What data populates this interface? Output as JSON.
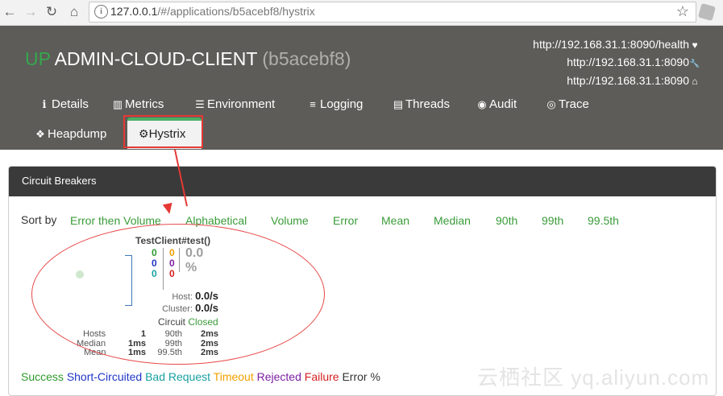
{
  "browser": {
    "url_host": "127.0.0.1",
    "url_path": "/#/applications/b5acebf8/hystrix",
    "lock_label": "i",
    "star_label": "☆"
  },
  "app": {
    "status": "UP",
    "name": "ADMIN-CLOUD-CLIENT",
    "id": "(b5acebf8)",
    "links": [
      {
        "text": "http://192.168.31.1:8090/health",
        "icon": "heartbeat-icon",
        "glyph": "♥"
      },
      {
        "text": "http://192.168.31.1:8090",
        "icon": "wrench-icon",
        "glyph": "🔧"
      },
      {
        "text": "http://192.168.31.1:8090",
        "icon": "home-icon",
        "glyph": "⌂"
      }
    ]
  },
  "tabs": [
    {
      "label": "Details",
      "icon": "info-icon",
      "glyph": "ℹ"
    },
    {
      "label": "Metrics",
      "icon": "bar-chart-icon",
      "glyph": "▥"
    },
    {
      "label": "Environment",
      "icon": "list-icon",
      "glyph": "☰"
    },
    {
      "label": "Logging",
      "icon": "sliders-icon",
      "glyph": "≡"
    },
    {
      "label": "Threads",
      "icon": "table-icon",
      "glyph": "▤"
    },
    {
      "label": "Audit",
      "icon": "user-circle-icon",
      "glyph": "◉"
    },
    {
      "label": "Trace",
      "icon": "eye-icon",
      "glyph": "◎"
    },
    {
      "label": "Heapdump",
      "icon": "cubes-icon",
      "glyph": "❖"
    },
    {
      "label": "Hystrix",
      "icon": "gear-icon",
      "glyph": "⚙",
      "active": true
    }
  ],
  "panel": {
    "title": "Circuit Breakers",
    "sort_label": "Sort by",
    "sort_options": [
      "Error then Volume",
      "Alphabetical",
      "Volume",
      "Error",
      "Mean",
      "Median",
      "90th",
      "99th",
      "99.5th"
    ]
  },
  "circuit": {
    "name": "TestClient#test()",
    "counts_left": [
      "0",
      "0",
      "0"
    ],
    "counts_right": [
      "0",
      "0",
      "0"
    ],
    "error_pct": "0.0 %",
    "host_label": "Host:",
    "host_rate": "0.0/s",
    "cluster_label": "Cluster:",
    "cluster_rate": "0.0/s",
    "circuit_label": "Circuit",
    "circuit_state": "Closed",
    "stats": {
      "labels_left": [
        "Hosts",
        "Median",
        "Mean"
      ],
      "values_left": [
        "1",
        "1ms",
        "1ms"
      ],
      "labels_right": [
        "90th",
        "99th",
        "99.5th"
      ],
      "values_right": [
        "2ms",
        "2ms",
        "2ms"
      ]
    }
  },
  "legend": [
    {
      "text": "Success",
      "color": "#2e9a2e"
    },
    {
      "text": "Short-Circuited",
      "color": "#1f35c8"
    },
    {
      "text": "Bad Request",
      "color": "#19a0a0"
    },
    {
      "text": "Timeout",
      "color": "#f0a000"
    },
    {
      "text": "Rejected",
      "color": "#7b1fa2"
    },
    {
      "text": "Failure",
      "color": "#d62020"
    },
    {
      "text": "Error %",
      "color": "#333333"
    }
  ],
  "watermark": "云栖社区 yq.aliyun.com"
}
